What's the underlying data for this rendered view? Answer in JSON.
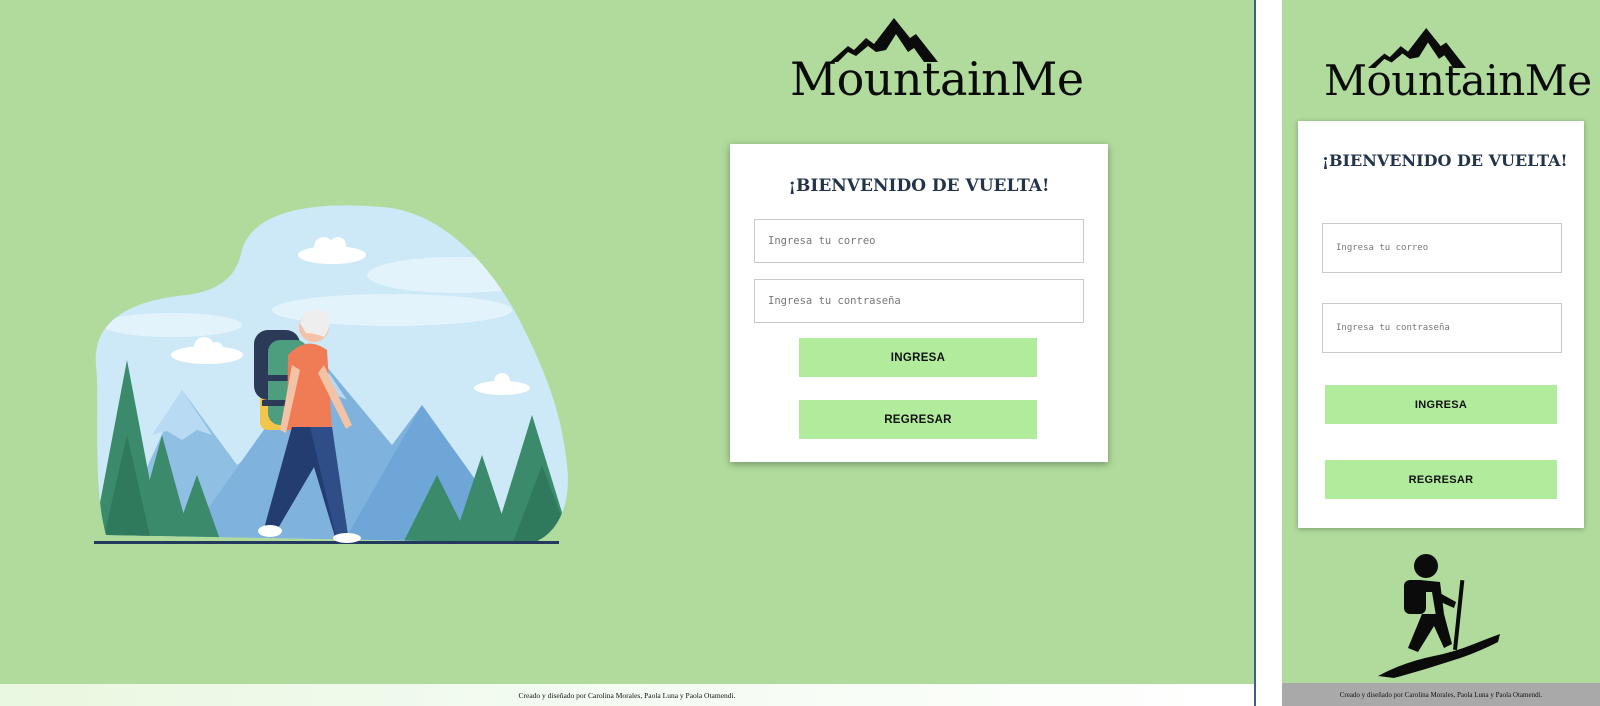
{
  "brand": {
    "name": "MountainMe"
  },
  "desktop": {
    "title": "¡BIENVENIDO DE VUELTA!",
    "email_placeholder": "Ingresa tu correo",
    "password_placeholder": "Ingresa tu contraseña",
    "login_label": "INGRESA",
    "back_label": "REGRESAR",
    "footer": "Creado y diseñado por Carolina Morales, Paola Luna y Paola Otamendi."
  },
  "mobile": {
    "title": "¡BIENVENIDO DE VUELTA!",
    "email_placeholder": "Ingresa tu correo",
    "password_placeholder": "Ingresa tu contraseña",
    "login_label": "INGRESA",
    "back_label": "REGRESAR",
    "footer": "Creado y diseñado por Carolina Morales, Paola Luna y Paola Otamendi."
  },
  "icons": {
    "logo_mark": "mountain-peaks-icon",
    "desktop_illustration": "hiker-illustration",
    "mobile_illustration": "hiker-silhouette-icon"
  },
  "colors": {
    "background": "#b0db9c",
    "button": "#b1ec9d",
    "title": "#23344a",
    "card": "#ffffff"
  }
}
